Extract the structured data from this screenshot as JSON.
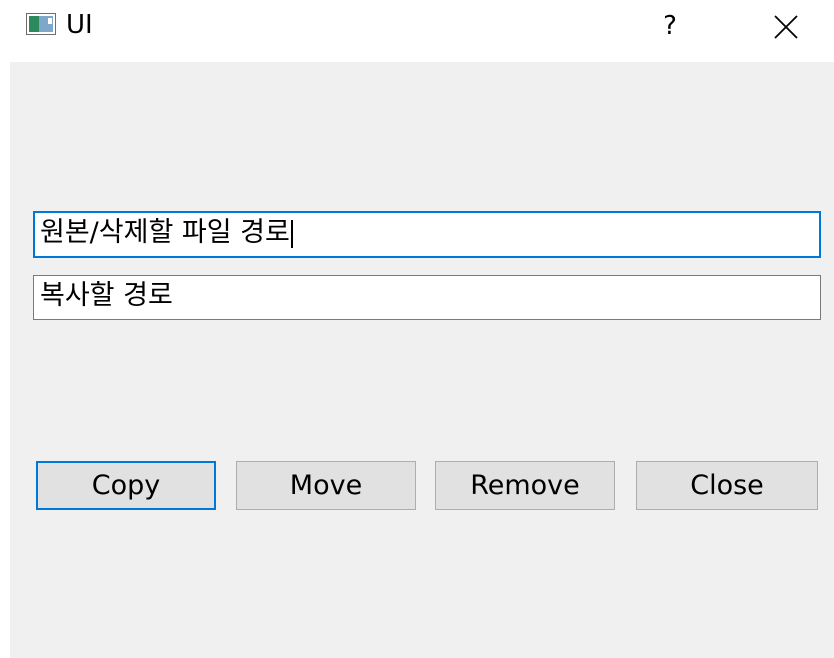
{
  "window": {
    "title": "UI",
    "help_label": "?",
    "close_icon": "close-icon",
    "app_icon": "app-window-icon"
  },
  "form": {
    "source_path": "원본/삭제할 파일 경로",
    "dest_path": "복사할 경로"
  },
  "buttons": {
    "copy": "Copy",
    "move": "Move",
    "remove": "Remove",
    "close": "Close"
  },
  "colors": {
    "focus_accent": "#0078d7",
    "client_background": "#f0f0f0",
    "button_face": "#e1e1e1"
  }
}
